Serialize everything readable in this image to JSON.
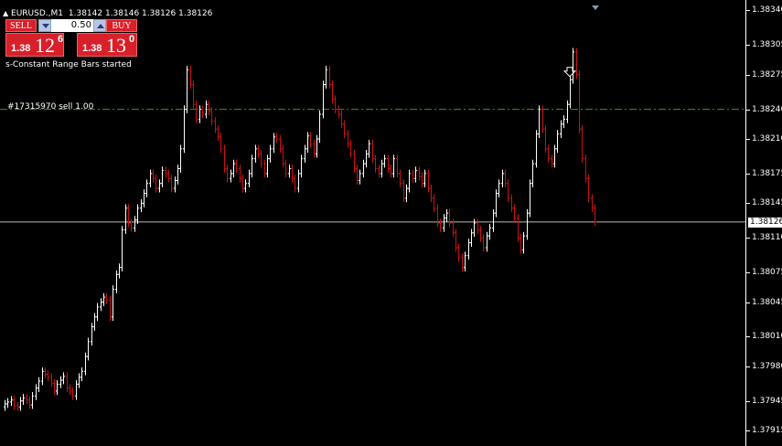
{
  "header": {
    "symbol_timeframe": "EURUSD.,M1",
    "ohlc": "1.38142 1.38146 1.38126 1.38126"
  },
  "trade_panel": {
    "sell_label": "SELL",
    "buy_label": "BUY",
    "lot_size": "0.50",
    "sell_price_prefix": "1.38",
    "sell_price_big": "12",
    "sell_price_small": "6",
    "buy_price_prefix": "1.38",
    "buy_price_big": "13",
    "buy_price_small": "0",
    "sell_color": "#d8202a"
  },
  "status_text": "s-Constant Range Bars started",
  "order": {
    "label": "#17315970 sell 1.00",
    "price": 1.3824,
    "line_color": "#2e9a3a"
  },
  "price_axis": {
    "labels": [
      "1.38340",
      "1.38305",
      "1.38275",
      "1.38240",
      "1.38210",
      "1.38175",
      "1.38145",
      "1.38110",
      "1.38075",
      "1.38045",
      "1.38010",
      "1.37980",
      "1.37945",
      "1.37915"
    ],
    "current_price": "1.38126"
  },
  "chart_data": {
    "type": "bar",
    "symbol": "EURUSD.",
    "timeframe": "M1",
    "ylim": [
      1.37905,
      1.38345
    ],
    "current_price": 1.38126,
    "up_color": "#ffffff",
    "down_color": "#cc1111",
    "closes": [
      1.37942,
      1.37944,
      1.37946,
      1.3794,
      1.37939,
      1.37945,
      1.37948,
      1.37946,
      1.37941,
      1.3795,
      1.37958,
      1.37965,
      1.37975,
      1.37972,
      1.37969,
      1.37963,
      1.37955,
      1.37962,
      1.37966,
      1.3797,
      1.37958,
      1.37955,
      1.3795,
      1.37962,
      1.37969,
      1.37975,
      1.3799,
      1.38005,
      1.3802,
      1.3803,
      1.3804,
      1.38045,
      1.3805,
      1.38047,
      1.3803,
      1.38058,
      1.38073,
      1.3808,
      1.38118,
      1.3814,
      1.38125,
      1.3812,
      1.38128,
      1.3814,
      1.38145,
      1.38155,
      1.38165,
      1.38175,
      1.3817,
      1.3816,
      1.38165,
      1.38178,
      1.38175,
      1.3817,
      1.3816,
      1.38168,
      1.3818,
      1.382,
      1.3824,
      1.3828,
      1.38265,
      1.38245,
      1.3823,
      1.3824,
      1.38235,
      1.38245,
      1.38238,
      1.38228,
      1.3822,
      1.38212,
      1.382,
      1.3818,
      1.3817,
      1.38175,
      1.38185,
      1.3818,
      1.3817,
      1.3816,
      1.38165,
      1.38175,
      1.3819,
      1.382,
      1.38195,
      1.38185,
      1.38175,
      1.3819,
      1.382,
      1.38212,
      1.3821,
      1.382,
      1.38185,
      1.38175,
      1.3818,
      1.3817,
      1.3816,
      1.38175,
      1.3819,
      1.382,
      1.38213,
      1.38205,
      1.38195,
      1.3821,
      1.38235,
      1.38265,
      1.3828,
      1.38265,
      1.3825,
      1.3824,
      1.38235,
      1.38225,
      1.38215,
      1.38205,
      1.38195,
      1.3818,
      1.38168,
      1.38175,
      1.38185,
      1.38195,
      1.38205,
      1.3819,
      1.3818,
      1.38175,
      1.38185,
      1.3819,
      1.3818,
      1.38175,
      1.3819,
      1.38175,
      1.38165,
      1.3815,
      1.3816,
      1.38175,
      1.3817,
      1.38178,
      1.38172,
      1.38165,
      1.38175,
      1.3816,
      1.3815,
      1.3814,
      1.38125,
      1.3812,
      1.3813,
      1.38135,
      1.38125,
      1.38115,
      1.381,
      1.3809,
      1.3808,
      1.38092,
      1.38105,
      1.38115,
      1.38125,
      1.38118,
      1.3811,
      1.381,
      1.38112,
      1.3812,
      1.38135,
      1.38155,
      1.38165,
      1.38175,
      1.38165,
      1.3815,
      1.3814,
      1.3813,
      1.3811,
      1.38098,
      1.38112,
      1.38135,
      1.38165,
      1.38185,
      1.38215,
      1.3824,
      1.3822,
      1.382,
      1.3819,
      1.38185,
      1.382,
      1.38215,
      1.38225,
      1.3823,
      1.38245,
      1.3827,
      1.38298,
      1.38275,
      1.3822,
      1.3819,
      1.3817,
      1.3815,
      1.3814,
      1.38126
    ]
  }
}
